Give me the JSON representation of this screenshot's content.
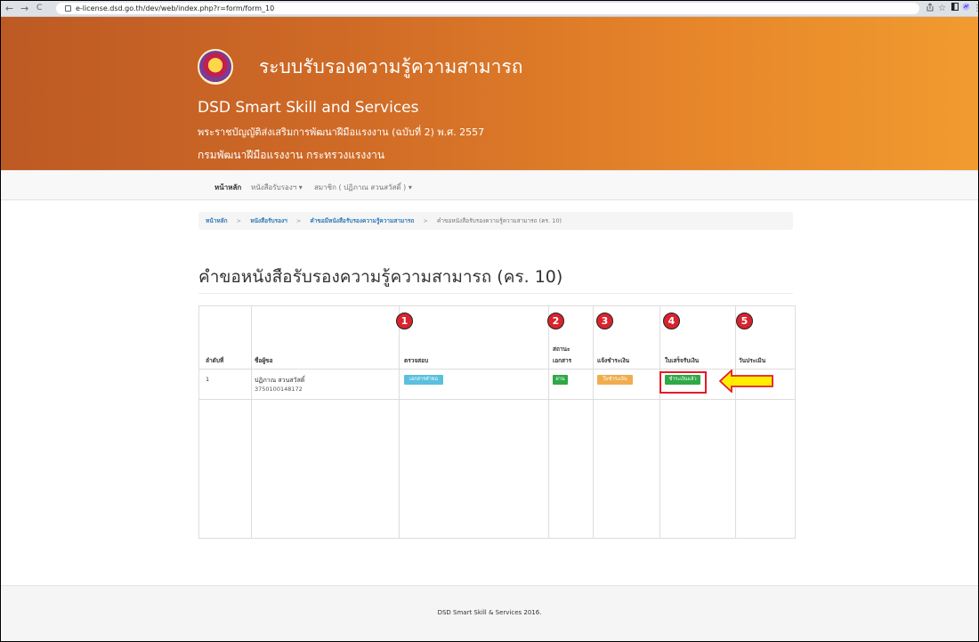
{
  "browser": {
    "back_glyph": "←",
    "forward_glyph": "→",
    "reload_glyph": "C",
    "url": "e-license.dsd.go.th/dev/web/index.php?r=form/form_10",
    "icons": [
      "share-icon",
      "star-icon",
      "sidebar-icon",
      "extension-icon",
      "menu-icon"
    ]
  },
  "header": {
    "system_title": "ระบบรับรองความรู้ความสามารถ",
    "brand": "DSD Smart Skill and Services",
    "act": "พระราชบัญญัติส่งเสริมการพัฒนาฝีมือแรงงาน (ฉบับที่ 2) พ.ศ. 2557",
    "department": "กรมพัฒนาฝีมือแรงงาน กระทรวงแรงงาน"
  },
  "navbar": {
    "home": "หน้าหลัก",
    "certificates": "หนังสือรับรองฯ ▾",
    "member": "สมาชิก ( ปฏิภาณ สวนสวัสดิ์ ) ▾"
  },
  "breadcrumb": {
    "home": "หน้าหลัก",
    "certificates": "หนังสือรับรองฯ",
    "request_list": "คำขอมีหนังสือรับรองความรู้ความสามารถ",
    "current": "คำขอหนังสือรับรองความรู้ความสามารถ (คร. 10)",
    "separator": ">"
  },
  "page_title": "คำขอหนังสือรับรองความรู้ความสามารถ (คร. 10)",
  "table": {
    "step_markers": [
      "1",
      "2",
      "3",
      "4",
      "5"
    ],
    "headers": {
      "no": "ลำดับที่",
      "name": "ชื่อผู้ขอ",
      "check": "ตรวจสอบ",
      "doc_status_1": "สถานะ",
      "doc_status_2": "เอกสาร",
      "payment_notice": "แจ้งชำระเงิน",
      "receipt": "ใบเสร็จรับเงิน",
      "assessment_date": "วันประเมิน"
    },
    "row": {
      "no": "1",
      "name": "ปฏิภาณ สวนสวัสดิ์",
      "id": "3750100148172",
      "check_button": "เอกสารคำขอ",
      "doc_status_button": "ผ่าน",
      "payment_button": "ใบชำระเงิน",
      "receipt_button": "ชำระเงินแล้ว"
    }
  },
  "footer": "DSD Smart Skill & Services 2016.",
  "colors": {
    "header_start": "#bd5a24",
    "header_end": "#f19b2f",
    "step_marker": "#d9232d",
    "tag_info": "#5bc0de",
    "tag_green": "#2fa847",
    "tag_orange": "#f0ad4e",
    "highlight": "#e41b2a",
    "arrow_fill": "#ffee00"
  }
}
